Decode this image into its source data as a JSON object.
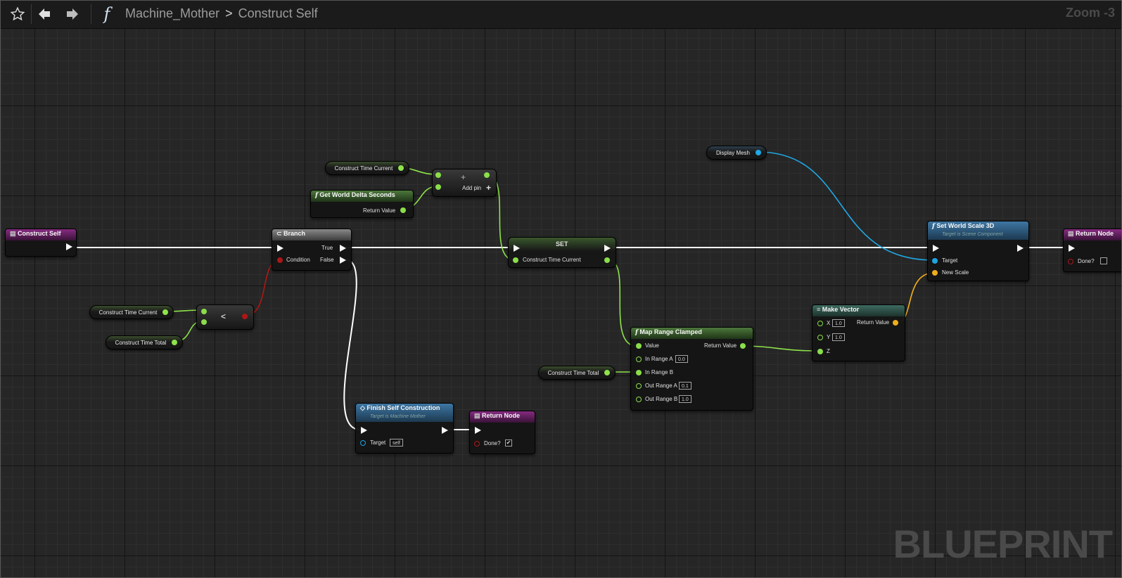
{
  "toolbar": {
    "breadcrumb_parent": "Machine_Mother",
    "breadcrumb_current": "Construct Self",
    "zoom": "Zoom -3",
    "func_glyph": "f"
  },
  "watermark": "BLUEPRINT",
  "nodes": {
    "construct_self": {
      "title": "Construct Self"
    },
    "branch": {
      "title": "Branch",
      "true": "True",
      "false": "False",
      "condition": "Condition"
    },
    "less": {
      "op": "<"
    },
    "ctc_left": {
      "label": "Construct Time Current"
    },
    "ctt_left": {
      "label": "Construct Time Total"
    },
    "ctc_top": {
      "label": "Construct Time Current"
    },
    "get_delta": {
      "title": "Get World Delta Seconds",
      "return": "Return Value"
    },
    "add": {
      "op": "+",
      "add_pin": "Add pin",
      "plus": "+"
    },
    "set": {
      "title": "SET",
      "var": "Construct Time Current"
    },
    "display_mesh": {
      "label": "Display Mesh"
    },
    "set_scale": {
      "title": "Set World Scale 3D",
      "subtitle": "Target is Scene Component",
      "target": "Target",
      "new_scale": "New Scale"
    },
    "return_right": {
      "title": "Return Node",
      "done": "Done?"
    },
    "map_range": {
      "title": "Map Range Clamped",
      "value": "Value",
      "return": "Return Value",
      "in_a": "In Range A",
      "in_a_val": "0.0",
      "in_b": "In Range B",
      "out_a": "Out Range A",
      "out_a_val": "0.1",
      "out_b": "Out Range B",
      "out_b_val": "1.0"
    },
    "ctt_mid": {
      "label": "Construct Time Total"
    },
    "make_vector": {
      "title": "Make Vector",
      "x": "X",
      "x_val": "1.0",
      "y": "Y",
      "y_val": "1.0",
      "z": "Z",
      "return": "Return Value"
    },
    "finish": {
      "title": "Finish Self Construction",
      "subtitle": "Target is Machine Mother",
      "target": "Target",
      "target_val": "self"
    },
    "return_mid": {
      "title": "Return Node",
      "done": "Done?",
      "check": "✔"
    }
  }
}
